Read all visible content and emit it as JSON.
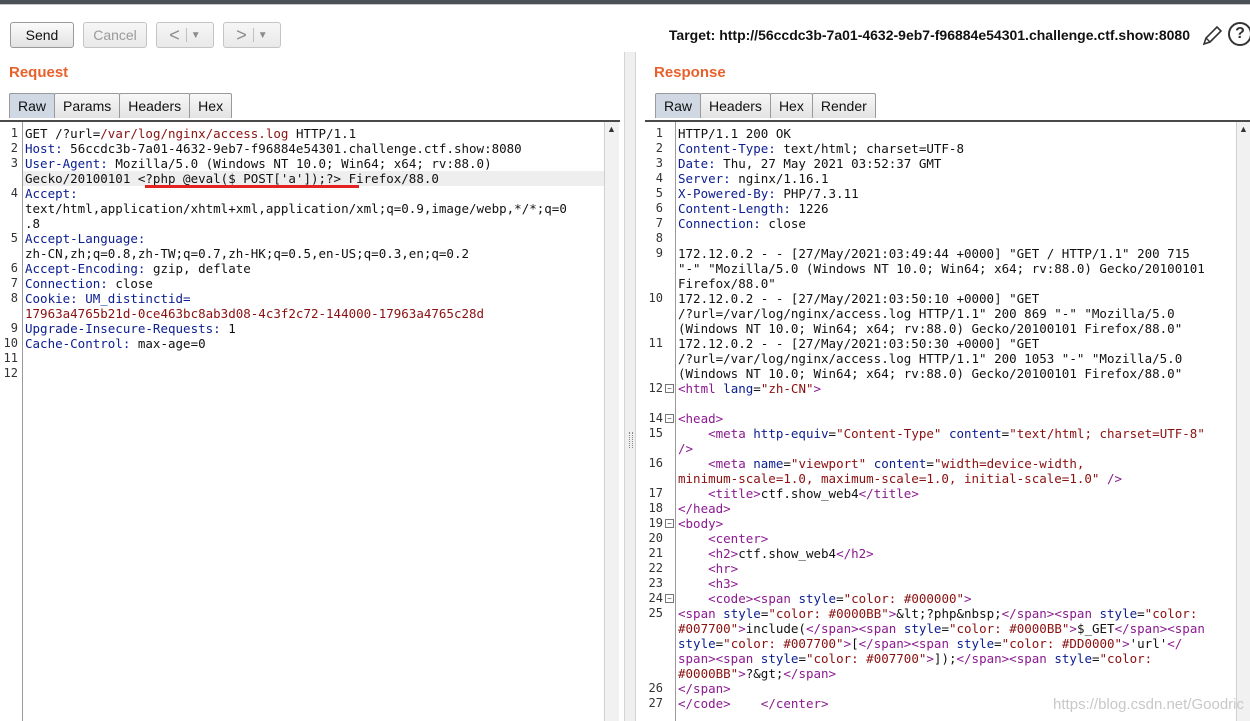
{
  "toolbar": {
    "send": "Send",
    "cancel": "Cancel",
    "back_glyph": "<",
    "forward_glyph": ">",
    "dropdown_glyph": "▼",
    "target": "Target: http://56ccdc3b-7a01-4632-9eb7-f96884e54301.challenge.ctf.show:8080",
    "edit_icon": "pencil-icon",
    "help_icon": "help-icon",
    "help_glyph": "?"
  },
  "request": {
    "title": "Request",
    "tabs": [
      "Raw",
      "Params",
      "Headers",
      "Hex"
    ],
    "active_tab": "Raw"
  },
  "response": {
    "title": "Response",
    "tabs": [
      "Raw",
      "Headers",
      "Hex",
      "Render"
    ],
    "active_tab": "Raw"
  },
  "colors": {
    "section_title": "#e8612c",
    "header_name": "#0b1d8f",
    "value_red": "#8a1010",
    "html_tag": "#8a1a8f",
    "underline": "#e52222"
  },
  "watermark": "https://blog.csdn.net/Goodric"
}
